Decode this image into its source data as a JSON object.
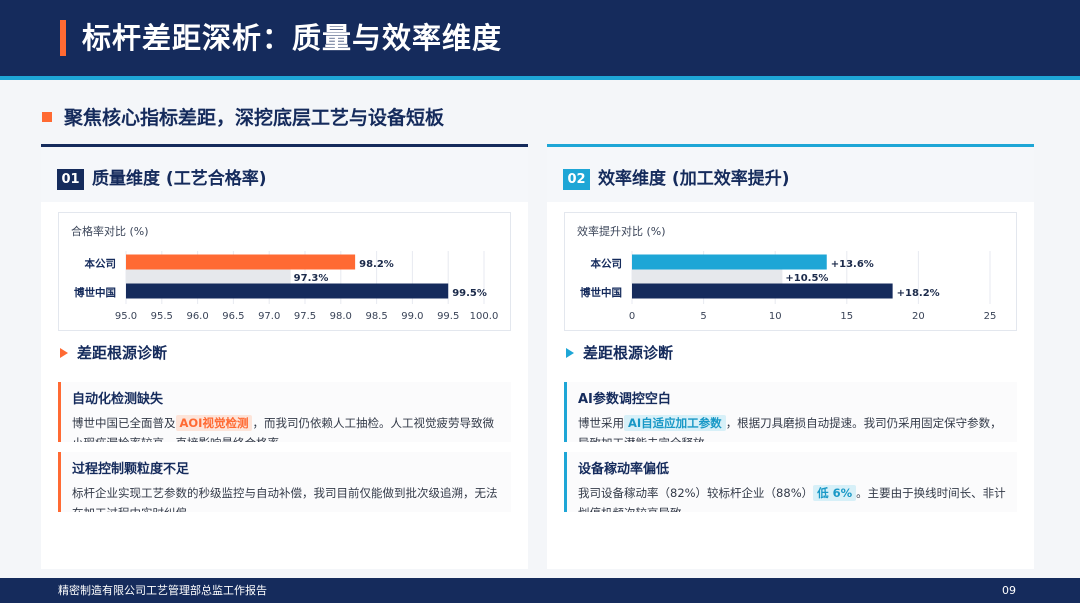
{
  "page": {
    "title": "标杆差距深析：质量与效率维度",
    "subtitle": "聚焦核心指标差距，深挖底层工艺与设备短板",
    "footer": "精密制造有限公司工艺管理部总监工作报告",
    "page_number": "09"
  },
  "colors": {
    "navy": "#152b5c",
    "orange": "#ff6a33",
    "cyan": "#1ea6d6",
    "gray_bar": "#e6e8ec"
  },
  "left": {
    "badge": "01",
    "title": "质量维度 (工艺合格率)",
    "diag_title": "差距根源诊断",
    "cards": [
      {
        "title": "自动化检测缺失",
        "pre": "博世中国已全面普及",
        "hl": "AOI视觉检测",
        "post": "，而我司仍依赖人工抽检。人工视觉疲劳导致微小瑕疵漏检率较高，直接影响最终合格率。"
      },
      {
        "title": "过程控制颗粒度不足",
        "pre": "标杆企业实现工艺参数的秒级监控与自动补偿，我司目前仅能做到批次级追溯，无法在加工过程中实时纠偏。",
        "hl": "",
        "post": ""
      }
    ]
  },
  "right": {
    "badge": "02",
    "title": "效率维度 (加工效率提升)",
    "diag_title": "差距根源诊断",
    "cards": [
      {
        "title": "AI参数调控空白",
        "pre": "博世采用",
        "hl": "AI自适应加工参数",
        "post": "，根据刀具磨损自动提速。我司仍采用固定保守参数，导致加工潜能未完全释放。"
      },
      {
        "title": "设备稼动率偏低",
        "pre": "我司设备稼动率（82%）较标杆企业（88%）",
        "hl": "低 6%",
        "post": "。主要由于换线时间长、非计划停机频次较高导致。"
      }
    ]
  },
  "chart_data": [
    {
      "type": "bar",
      "orientation": "horizontal",
      "title": "合格率对比 (%)",
      "categories": [
        "本公司",
        "博世中国"
      ],
      "series": [
        {
          "values": [
            98.2,
            99.5
          ],
          "colors": [
            "#ff6a33",
            "#152b5c"
          ],
          "labels": [
            "98.2%",
            "99.5%"
          ]
        },
        {
          "values": [
            97.3
          ],
          "colors": [
            "#e6e8ec"
          ],
          "labels": [
            "97.3%"
          ]
        }
      ],
      "xlim": [
        95.0,
        100.0
      ],
      "xticks": [
        "95.0",
        "95.5",
        "96.0",
        "96.5",
        "97.0",
        "97.5",
        "98.0",
        "98.5",
        "99.0",
        "99.5",
        "100.0"
      ],
      "grid": true
    },
    {
      "type": "bar",
      "orientation": "horizontal",
      "title": "效率提升对比 (%)",
      "categories": [
        "本公司",
        "博世中国"
      ],
      "series": [
        {
          "values": [
            13.6,
            18.2
          ],
          "colors": [
            "#1ea6d6",
            "#152b5c"
          ],
          "labels": [
            "+13.6%",
            "+18.2%"
          ]
        },
        {
          "values": [
            10.5
          ],
          "colors": [
            "#e6e8ec"
          ],
          "labels": [
            "+10.5%"
          ]
        }
      ],
      "xlim": [
        0,
        25
      ],
      "xticks": [
        "0",
        "5",
        "10",
        "15",
        "20",
        "25"
      ],
      "grid": true
    }
  ]
}
